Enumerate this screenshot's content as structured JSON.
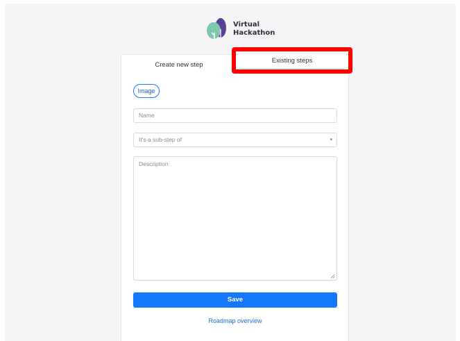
{
  "logo": {
    "line1": "Virtual",
    "line2": "Hackathon",
    "colors": {
      "green": "#7ec8b0",
      "purple": "#5b3e96",
      "stem": "#ffffff"
    }
  },
  "tabs": [
    {
      "label": "Create new step",
      "active": true
    },
    {
      "label": "Existing steps",
      "active": false,
      "highlighted": true
    }
  ],
  "form": {
    "image_button": "Image",
    "name_placeholder": "Name",
    "substep_placeholder": "It's a sub-step of",
    "description_placeholder": "Description",
    "save_label": "Save"
  },
  "footer": {
    "roadmap_link": "Roadmap overview"
  },
  "colors": {
    "accent": "#1677ff",
    "highlight": "#ff0000",
    "background": "#f4f4f6"
  }
}
